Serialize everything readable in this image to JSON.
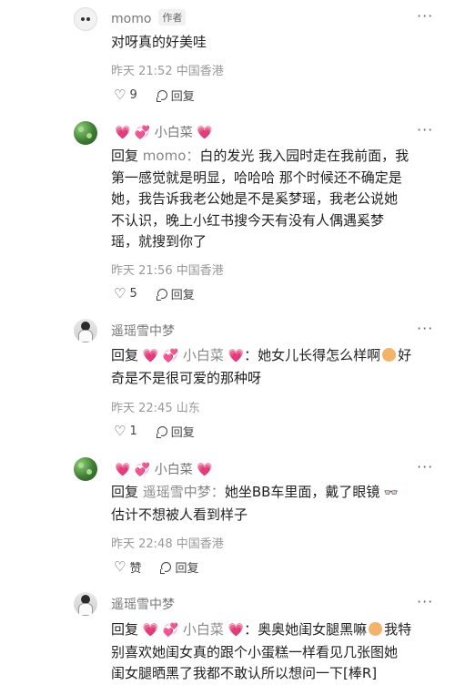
{
  "comments": [
    {
      "author": "momo",
      "author_tag": "作者",
      "hearts_left": "",
      "hearts_right": "",
      "more": "···",
      "reply_prefix": "",
      "reply_to": "",
      "lines": [
        "对呀真的好美哇"
      ],
      "time": "昨天 21:52",
      "location": "中国香港",
      "likes": "9",
      "reply_label": "回复",
      "avatar": "cat-avatar"
    },
    {
      "author": "小白菜",
      "hearts_left": "💗 💞",
      "hearts_right": "💗",
      "more": "···",
      "reply_prefix": "回复",
      "reply_to": "momo：",
      "lines": [
        "白的发光 我入园时走在我前面，我",
        "第一感觉就是明显，哈哈哈 那个时候还不确定是",
        "她，我告诉我老公她是不是奚梦瑶，我老公说她",
        "不认识，晚上小红书搜今天有没有人偶遇奚梦",
        "瑶，就搜到你了"
      ],
      "time": "昨天 21:56",
      "location": "中国香港",
      "likes": "5",
      "reply_label": "回复",
      "avatar": "green-avatar"
    },
    {
      "author": "遥瑶雪中梦",
      "hearts_left": "",
      "hearts_right": "",
      "more": "···",
      "reply_prefix": "回复",
      "reply_to_hearts_left": "💗 💞",
      "reply_to": "小白菜",
      "reply_to_hearts_right": "💗",
      "lines": [
        "：她女儿长得怎么样啊",
        "奇是不是很可爱的那种呀"
      ],
      "line1_suffix": "好",
      "time": "昨天 22:45",
      "location": "山东",
      "likes": "1",
      "reply_label": "回复",
      "avatar": "girl-avatar"
    },
    {
      "author": "小白菜",
      "hearts_left": "💗 💞",
      "hearts_right": "💗",
      "more": "···",
      "reply_prefix": "回复",
      "reply_to": "遥瑶雪中梦：",
      "lines": [
        "她坐BB车里面，戴了眼镜",
        "估计不想被人看到样子"
      ],
      "time": "昨天 22:48",
      "location": "中国香港",
      "likes": "赞",
      "reply_label": "回复",
      "avatar": "green-avatar"
    },
    {
      "author": "遥瑶雪中梦",
      "hearts_left": "",
      "hearts_right": "",
      "more": "···",
      "reply_prefix": "回复",
      "reply_to_hearts_left": "💗 💞",
      "reply_to": "小白菜",
      "reply_to_hearts_right": "💗",
      "lines": [
        "：奥奥她闺女腿黑嘛",
        "我特",
        "别喜欢她闺女真的跟个小蛋糕一样看见几张图她",
        "闺女腿晒黑了我都不敢认所以想问一下[棒R]"
      ],
      "avatar": "girl-avatar"
    }
  ],
  "icons": {
    "like": "heart-outline-icon",
    "reply": "speech-bubble-icon",
    "more": "ellipsis-icon"
  }
}
